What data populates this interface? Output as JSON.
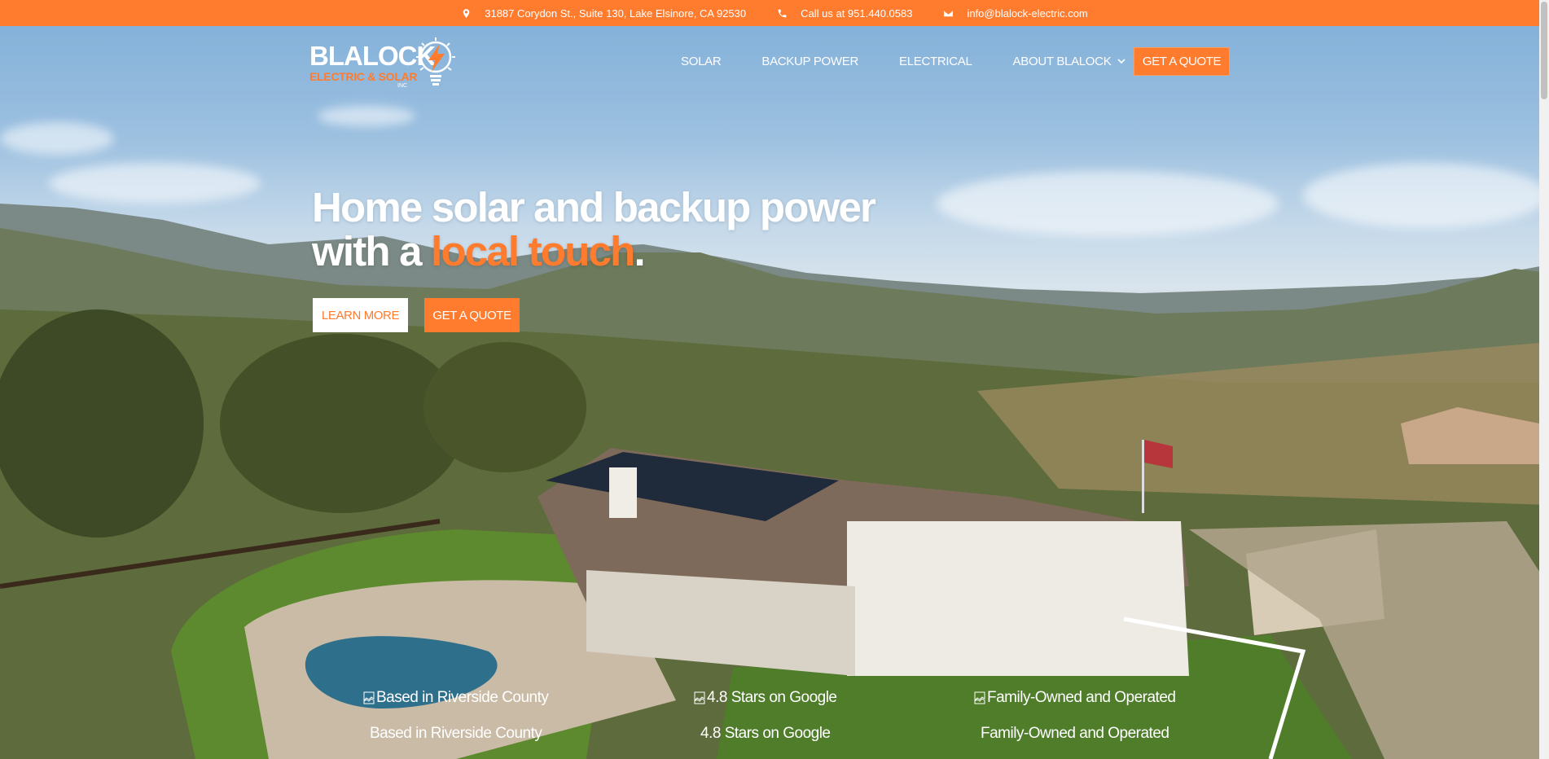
{
  "topbar": {
    "address": "31887 Corydon St., Suite 130, Lake Elsinore, CA 92530",
    "phone": "Call us at 951.440.0583",
    "email": "info@blalock-electric.com",
    "icons": [
      "map-pin-icon",
      "phone-icon",
      "envelope-icon"
    ]
  },
  "logo": {
    "name": "BLALOCK",
    "tagline": "ELECTRIC & SOLAR",
    "suffix": "INC"
  },
  "nav": {
    "items": [
      {
        "label": "SOLAR"
      },
      {
        "label": "BACKUP POWER"
      },
      {
        "label": "ELECTRICAL"
      },
      {
        "label": "ABOUT BLALOCK"
      }
    ],
    "quote_label": "GET A QUOTE"
  },
  "hero": {
    "line1": "Home solar and backup power",
    "line2_prefix": "with a ",
    "line2_accent": "local touch",
    "line2_suffix": ".",
    "learn_more": "LEARN MORE",
    "get_quote": "GET A QUOTE"
  },
  "features": [
    {
      "alt": "Based in Riverside County",
      "caption": "Based in Riverside County"
    },
    {
      "alt": "4.8 Stars on Google",
      "caption": "4.8 Stars on Google"
    },
    {
      "alt": "Family-Owned and Operated",
      "caption": "Family-Owned and Operated"
    }
  ],
  "colors": {
    "brand": "#ff7b2e",
    "text_light": "#ffffff"
  }
}
